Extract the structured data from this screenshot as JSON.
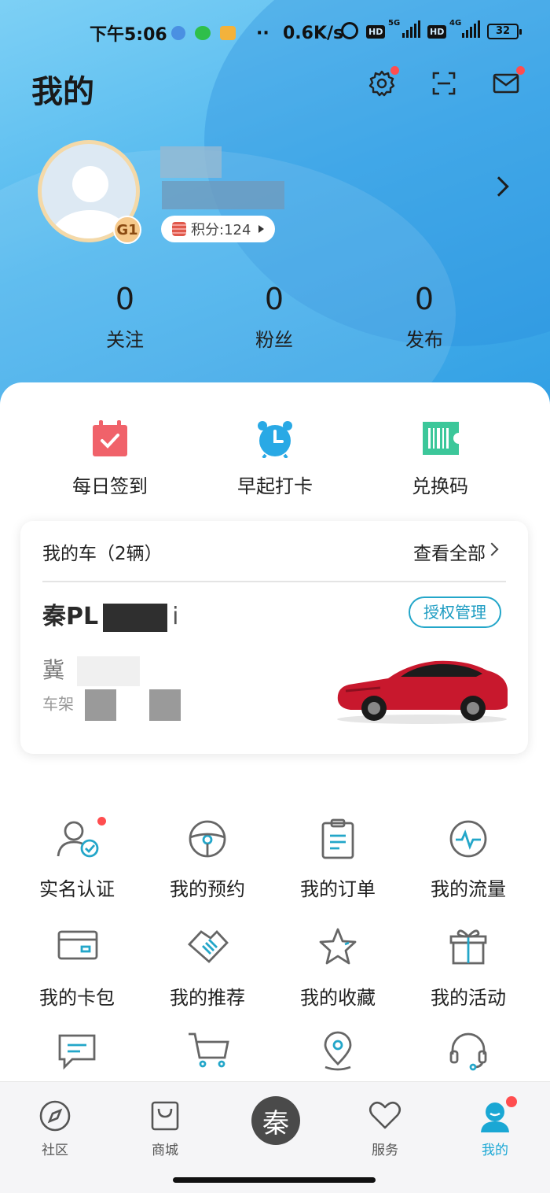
{
  "status_bar": {
    "time": "下午5:06",
    "net_speed": "0.6K/s",
    "hd1": "HD",
    "gen1": "5G",
    "hd2": "HD",
    "gen2": "4G",
    "battery": "32"
  },
  "header": {
    "title": "我的",
    "icons": [
      "settings-icon",
      "scan-icon",
      "message-icon"
    ]
  },
  "profile": {
    "level": "G1",
    "points_label": "积分:124"
  },
  "stats": [
    {
      "value": "0",
      "label": "关注"
    },
    {
      "value": "0",
      "label": "粉丝"
    },
    {
      "value": "0",
      "label": "发布"
    }
  ],
  "quick_actions": [
    {
      "label": "每日签到",
      "icon": "calendar-check-icon",
      "color": "#f0626a"
    },
    {
      "label": "早起打卡",
      "icon": "alarm-clock-icon",
      "color": "#29a9e5"
    },
    {
      "label": "兑换码",
      "icon": "barcode-ticket-icon",
      "color": "#3cc79a"
    }
  ],
  "my_car": {
    "header": "我的车（2辆）",
    "view_all": "查看全部",
    "model": "秦PL",
    "model_suffix": "i",
    "auth_button": "授权管理",
    "plate": "冀",
    "vin_label": "车架"
  },
  "grid": [
    {
      "label": "实名认证",
      "icon": "verified-user-icon"
    },
    {
      "label": "我的预约",
      "icon": "steering-wheel-icon"
    },
    {
      "label": "我的订单",
      "icon": "order-list-icon"
    },
    {
      "label": "我的流量",
      "icon": "data-pulse-icon"
    },
    {
      "label": "我的卡包",
      "icon": "card-wallet-icon"
    },
    {
      "label": "我的推荐",
      "icon": "handshake-icon"
    },
    {
      "label": "我的收藏",
      "icon": "star-icon"
    },
    {
      "label": "我的活动",
      "icon": "gift-icon"
    }
  ],
  "bottom_nav": [
    {
      "label": "社区",
      "icon": "compass-icon"
    },
    {
      "label": "商城",
      "icon": "shopping-bag-icon"
    },
    {
      "label": "",
      "icon": "qin-logo"
    },
    {
      "label": "服务",
      "icon": "heart-icon"
    },
    {
      "label": "我的",
      "icon": "profile-icon"
    }
  ],
  "colors": {
    "accent": "#1d9cc2",
    "badge": "#ff4d4f",
    "header_blue": "#4fb6ee"
  }
}
